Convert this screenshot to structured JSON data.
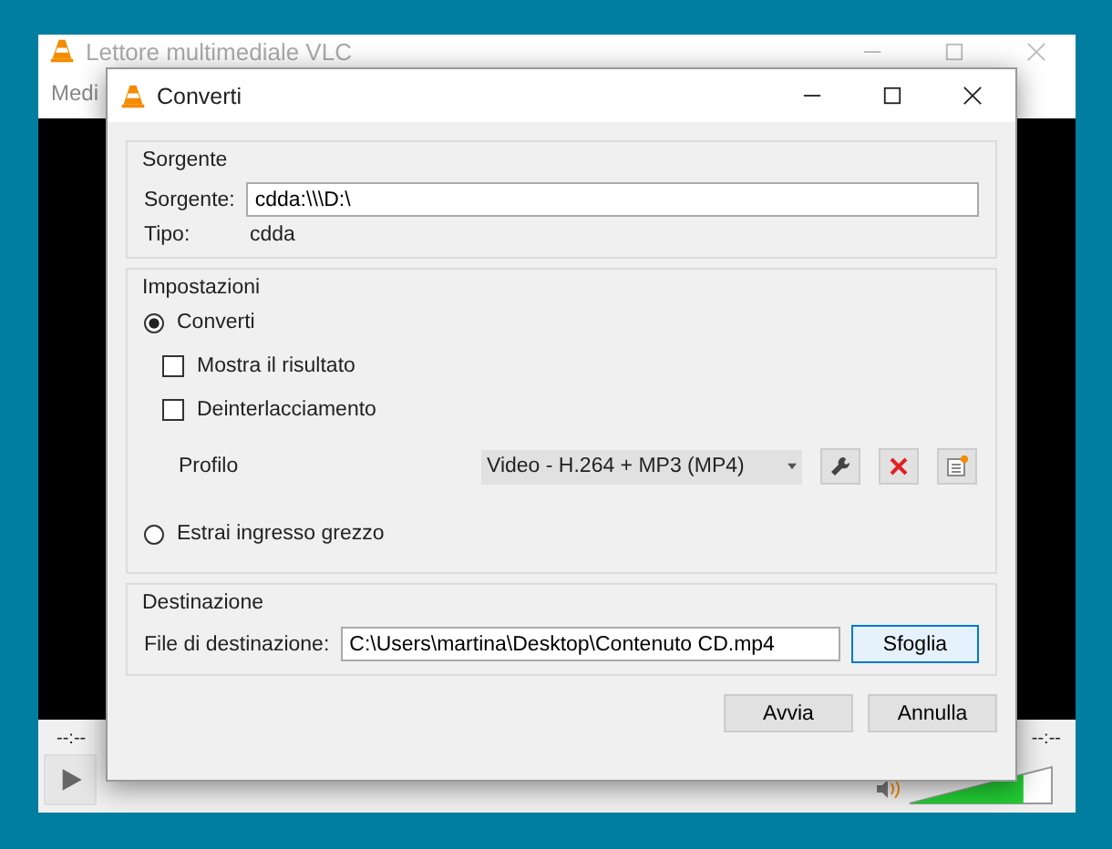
{
  "main_window": {
    "title": "Lettore multimediale VLC",
    "menu": [
      "Medi"
    ],
    "time_elapsed": "--:--",
    "time_total": "--:--",
    "volume": {
      "level": 0.8
    }
  },
  "dialog": {
    "title": "Converti",
    "source": {
      "legend": "Sorgente",
      "label": "Sorgente:",
      "value": "cdda:\\\\\\D:\\",
      "type_label": "Tipo:",
      "type_value": "cdda"
    },
    "settings": {
      "legend": "Impostazioni",
      "options": [
        {
          "kind": "radio",
          "label": "Converti",
          "selected": true,
          "children": [
            {
              "kind": "checkbox",
              "label": "Mostra il risultato",
              "checked": false
            },
            {
              "kind": "checkbox",
              "label": "Deinterlacciamento",
              "checked": false
            }
          ]
        },
        {
          "kind": "radio",
          "label": "Estrai ingresso grezzo",
          "selected": false
        }
      ],
      "profile_label": "Profilo",
      "profile_value": "Video - H.264 + MP3 (MP4)"
    },
    "destination": {
      "legend": "Destinazione",
      "label": "File di destinazione:",
      "value": "C:\\Users\\martina\\Desktop\\Contenuto CD.mp4",
      "browse": "Sfoglia"
    },
    "buttons": [
      "Avvia",
      "Annulla"
    ]
  }
}
